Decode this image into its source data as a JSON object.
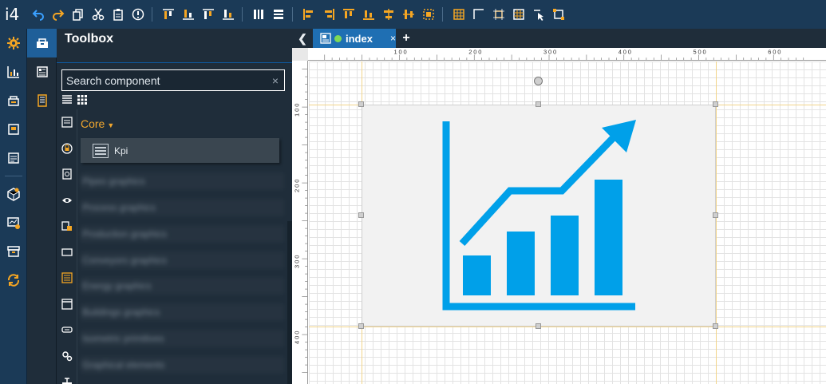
{
  "app": {
    "logo": "i4"
  },
  "toolbar": {
    "items": [
      "undo-icon",
      "redo-icon",
      "copy-icon",
      "cut-icon",
      "paste-icon",
      "error-icon",
      "align-top-icon",
      "align-bottom-icon",
      "align-middle-icon",
      "align-baseline-icon",
      "distribute-h-icon",
      "distribute-v-icon",
      "align-left-icon",
      "align-right-icon",
      "align-top-edge-icon",
      "align-bottom-edge-icon",
      "center-h-icon",
      "center-v-icon",
      "center-icon",
      "grid-icon",
      "corner-icon",
      "fit-icon",
      "table-icon",
      "select-icon",
      "frame-icon"
    ]
  },
  "toolbox": {
    "title": "Toolbox",
    "search": {
      "placeholder": "Search component",
      "clear": "×"
    },
    "category": "Core",
    "items": [
      {
        "label": "Kpi",
        "icon": "kpi-icon"
      }
    ],
    "blurred_categories": [
      "Pipes graphics",
      "Process graphics",
      "Production graphics",
      "Conveyors graphics",
      "Energy graphics",
      "Buildings graphics",
      "Isometric primitives",
      "Graphical elements"
    ]
  },
  "editor": {
    "tab": {
      "label": "index",
      "close": "×",
      "status_color": "#7ed957"
    },
    "add_tab": "+",
    "ruler_h_labels": [
      "100",
      "200",
      "300",
      "400",
      "500",
      "600"
    ],
    "ruler_v_labels": [
      "100",
      "200",
      "300",
      "400"
    ]
  },
  "colors": {
    "accent": "#1f6fb3",
    "chart": "#00a0e9",
    "category": "#f0a62e",
    "toolbar_icon": "#f5a623"
  }
}
